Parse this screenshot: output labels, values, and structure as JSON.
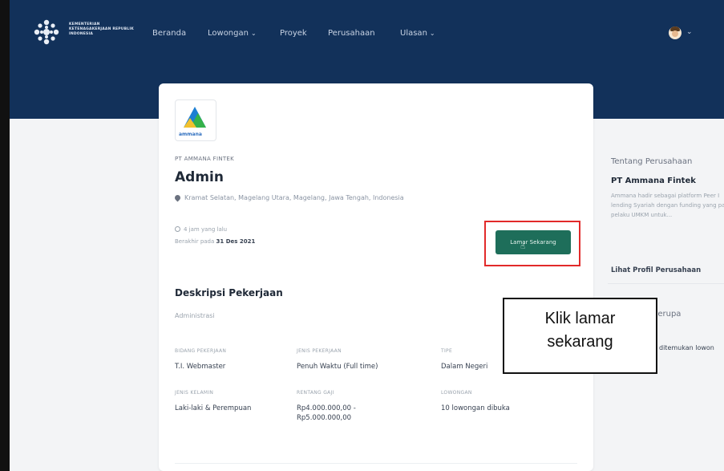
{
  "colors": {
    "header_bg": "#12315a",
    "primary_button": "#1e6e5a",
    "highlight_border": "#e22a2a"
  },
  "header": {
    "logo_text": "KEMENTERIAN KETENAGAKERJAAN REPUBLIK INDONESIA",
    "nav": [
      {
        "label": "Beranda"
      },
      {
        "label": "Lowongan",
        "dropdown": true
      },
      {
        "label": "Proyek"
      },
      {
        "label": "Perusahaan"
      },
      {
        "label": "Ulasan",
        "dropdown": true
      }
    ],
    "avatar_icon": "user-avatar"
  },
  "job": {
    "company_logo_text": "ammana",
    "company_name_small": "PT AMMANA FINTEK",
    "title": "Admin",
    "location": "Kramat Selatan, Magelang Utara, Magelang, Jawa Tengah, Indonesia",
    "posted": "4 jam yang lalu",
    "deadline_prefix": "Berakhir pada",
    "deadline_date": "31 Des 2021",
    "apply_button": "Lamar Sekarang",
    "description_heading": "Deskripsi Pekerjaan",
    "description_text": "Administrasi",
    "details": [
      {
        "label": "BIDANG PEKERJAAN",
        "value": "T.I. Webmaster"
      },
      {
        "label": "JENIS PEKERJAAN",
        "value": "Penuh Waktu (Full time)"
      },
      {
        "label": "TIPE",
        "value": "Dalam Negeri"
      },
      {
        "label": "JENIS KELAMIN",
        "value": "Laki-laki & Perempuan"
      },
      {
        "label": "RENTANG GAJI",
        "value": "Rp4.000.000,00 - Rp5.000.000,00"
      },
      {
        "label": "LOWONGAN",
        "value": "10 lowongan dibuka"
      }
    ]
  },
  "sidebar": {
    "about_heading": "Tentang Perusahaan",
    "company_name": "PT Ammana Fintek",
    "company_desc": "Ammana hadir sebagai platform Peer I lending Syariah dengan funding yang para pelaku UMKM untuk...",
    "profile_link": "Lihat Profil Perusahaan",
    "similar_heading": "Serupa",
    "similar_empty": "ditemukan lowon"
  },
  "callout": {
    "line1": "Klik lamar",
    "line2": "sekarang"
  }
}
